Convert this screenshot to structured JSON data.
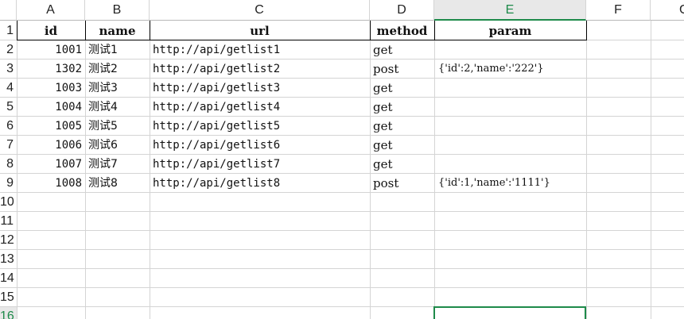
{
  "columns": [
    "A",
    "B",
    "C",
    "D",
    "E",
    "F",
    "G"
  ],
  "rows": [
    "1",
    "2",
    "3",
    "4",
    "5",
    "6",
    "7",
    "8",
    "9",
    "10",
    "11",
    "12",
    "13",
    "14",
    "15",
    "16"
  ],
  "header": {
    "id": "id",
    "name": "name",
    "url": "url",
    "method": "method",
    "param": "param"
  },
  "records": [
    {
      "id": "1001",
      "name": "测试1",
      "url": "http://api/getlist1",
      "method": "get",
      "param": ""
    },
    {
      "id": "1302",
      "name": "测试2",
      "url": "http://api/getlist2",
      "method": "post",
      "param": "{'id':2,'name':'222'}"
    },
    {
      "id": "1003",
      "name": "测试3",
      "url": "http://api/getlist3",
      "method": "get",
      "param": ""
    },
    {
      "id": "1004",
      "name": "测试4",
      "url": "http://api/getlist4",
      "method": "get",
      "param": ""
    },
    {
      "id": "1005",
      "name": "测试5",
      "url": "http://api/getlist5",
      "method": "get",
      "param": ""
    },
    {
      "id": "1006",
      "name": "测试6",
      "url": "http://api/getlist6",
      "method": "get",
      "param": ""
    },
    {
      "id": "1007",
      "name": "测试7",
      "url": "http://api/getlist7",
      "method": "get",
      "param": ""
    },
    {
      "id": "1008",
      "name": "测试8",
      "url": "http://api/getlist8",
      "method": "post",
      "param": "{'id':1,'name':'1111'}"
    }
  ],
  "selection": {
    "column": "E",
    "row": "16"
  },
  "colors": {
    "accent": "#1e8a4a",
    "gridline": "#d4d4d4",
    "header_bg": "#e8e8e8"
  }
}
